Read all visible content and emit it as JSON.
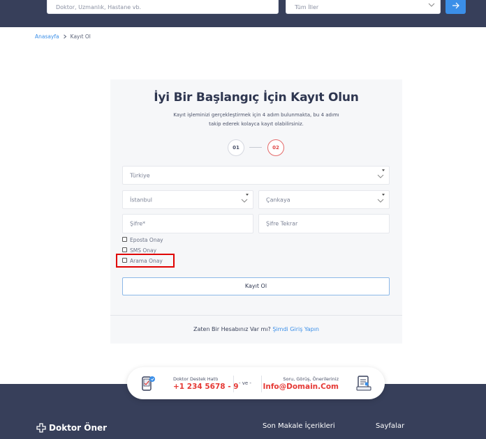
{
  "search": {
    "placeholder": "Doktor, Uzmanlık, Hastane vb.",
    "city_value": "Tüm İller"
  },
  "breadcrumb": {
    "home": "Anasayfa",
    "current": "Kayıt Ol"
  },
  "form": {
    "title": "İyi Bir Başlangıç İçin Kayıt Olun",
    "subtitle_line1": "Kayıt işleminizi gerçekleştirmek için 4 adım bulunmakta, bu 4 adımı",
    "subtitle_line2": "takip ederek kolayca kayıt olabilirsiniz.",
    "step1": "01",
    "step2": "02",
    "country": "Türkiye",
    "city": "İstanbul",
    "district": "Çankaya",
    "password_placeholder": "Şifre*",
    "password_repeat_placeholder": "Şifre Tekrar",
    "checkboxes": [
      "Eposta Onay",
      "SMS Onay",
      "Arama Onay"
    ],
    "submit_label": "Kayıt Ol",
    "login_prompt": "Zaten Bir Hesabınız Var mı?",
    "login_link": "Şimdi Giriş Yapın"
  },
  "contact": {
    "hotline_label": "Doktor Destek Hattı",
    "hotline_number": "+1 234 5678 - 9",
    "separator": "- ve -",
    "feedback_label": "Soru, Görüş, Önerileriniz",
    "feedback_email": "Info@Domain.Com"
  },
  "footer": {
    "logo_text": "Doktor Öner",
    "heading_articles": "Son Makale İçerikleri",
    "heading_pages": "Sayfalar"
  },
  "colors": {
    "dark_band": "#373f5a",
    "accent_blue": "#3b8fe8",
    "accent_red": "#e53935",
    "highlight_box": "#e00000"
  },
  "icons": [
    "arrow-right-icon",
    "chevron-down-icon",
    "chevron-right-icon",
    "phone-support-icon",
    "feedback-document-icon",
    "logo-cross-icon"
  ]
}
